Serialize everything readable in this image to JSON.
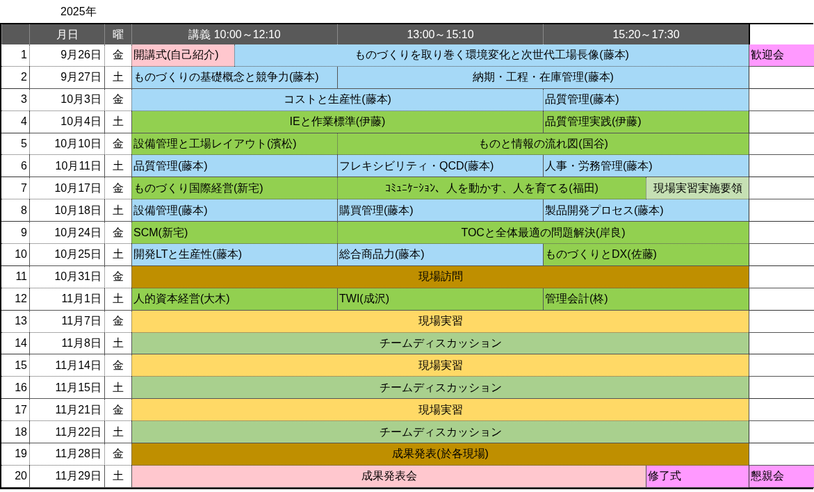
{
  "year": "2025年",
  "columns": [
    "",
    "月日",
    "曜",
    "講義 10:00～12:10",
    "13:00～15:10",
    "15:20～17:30"
  ],
  "rows": [
    {
      "no": "1",
      "date": "9月26日",
      "weekday": "金",
      "sessions": [
        {
          "text": "開講式(自己紹介)",
          "kind": "half",
          "centered": false,
          "color": "#ffc7ce"
        },
        {
          "text": "ものづくりを取り巻く環境変化と次世代工場長像(藤本)",
          "kind": "twoandhalf",
          "centered": true,
          "color": "#a6d9f7"
        }
      ],
      "extra": {
        "text": "歓迎会",
        "color": "#ff99ff"
      }
    },
    {
      "no": "2",
      "date": "9月27日",
      "weekday": "土",
      "sessions": [
        {
          "text": "ものづくりの基礎概念と競争力(藤本)",
          "kind": "one",
          "centered": false,
          "color": "#a6d9f7"
        },
        {
          "text": "納期・工程・在庫管理(藤本)",
          "kind": "two",
          "centered": true,
          "color": "#a6d9f7"
        }
      ]
    },
    {
      "no": "3",
      "date": "10月3日",
      "weekday": "金",
      "sessions": [
        {
          "text": "コストと生産性(藤本)",
          "kind": "two",
          "centered": true,
          "color": "#a6d9f7"
        },
        {
          "text": "品質管理(藤本)",
          "kind": "one",
          "centered": false,
          "color": "#a6d9f7"
        }
      ]
    },
    {
      "no": "4",
      "date": "10月4日",
      "weekday": "土",
      "sessions": [
        {
          "text": "IEと作業標準(伊藤)",
          "kind": "two",
          "centered": true,
          "color": "#92d050"
        },
        {
          "text": "品質管理実践(伊藤)",
          "kind": "one",
          "centered": false,
          "color": "#92d050"
        }
      ]
    },
    {
      "no": "5",
      "date": "10月10日",
      "weekday": "金",
      "sessions": [
        {
          "text": "設備管理と工場レイアウト(濱松)",
          "kind": "one",
          "centered": false,
          "color": "#92d050"
        },
        {
          "text": "ものと情報の流れ図(国谷)",
          "kind": "two",
          "centered": true,
          "color": "#92d050"
        }
      ]
    },
    {
      "no": "6",
      "date": "10月11日",
      "weekday": "土",
      "sessions": [
        {
          "text": "品質管理(藤本)",
          "kind": "one",
          "centered": false,
          "color": "#a6d9f7"
        },
        {
          "text": "フレキシビリティ・QCD(藤本)",
          "kind": "one",
          "centered": false,
          "color": "#a6d9f7"
        },
        {
          "text": "人事・労務管理(藤本)",
          "kind": "one",
          "centered": false,
          "color": "#a6d9f7"
        }
      ]
    },
    {
      "no": "7",
      "date": "10月17日",
      "weekday": "金",
      "sessions": [
        {
          "text": "ものづくり国際経営(新宅)",
          "kind": "one",
          "centered": false,
          "color": "#92d050"
        },
        {
          "text": "ｺﾐｭﾆｹｰｼｮﾝ、人を動かす、人を育てる(福田)",
          "kind": "oneandhalf",
          "centered": true,
          "color": "#92d050"
        },
        {
          "text": "現場実習実施要領",
          "kind": "half",
          "centered": true,
          "color": "#c6e0b4"
        }
      ]
    },
    {
      "no": "8",
      "date": "10月18日",
      "weekday": "土",
      "sessions": [
        {
          "text": "設備管理(藤本)",
          "kind": "one",
          "centered": false,
          "color": "#a6d9f7"
        },
        {
          "text": "購買管理(藤本)",
          "kind": "one",
          "centered": false,
          "color": "#a6d9f7"
        },
        {
          "text": "製品開発プロセス(藤本)",
          "kind": "one",
          "centered": false,
          "color": "#a6d9f7"
        }
      ]
    },
    {
      "no": "9",
      "date": "10月24日",
      "weekday": "金",
      "sessions": [
        {
          "text": "SCM(新宅)",
          "kind": "one",
          "centered": false,
          "color": "#92d050"
        },
        {
          "text": "TOCと全体最適の問題解決(岸良)",
          "kind": "two",
          "centered": true,
          "color": "#92d050"
        }
      ]
    },
    {
      "no": "10",
      "date": "10月25日",
      "weekday": "土",
      "sessions": [
        {
          "text": "開発LTと生産性(藤本)",
          "kind": "one",
          "centered": false,
          "color": "#a6d9f7"
        },
        {
          "text": "総合商品力(藤本)",
          "kind": "one",
          "centered": false,
          "color": "#a6d9f7"
        },
        {
          "text": "ものづくりとDX(佐藤)",
          "kind": "one",
          "centered": false,
          "color": "#92d050"
        }
      ]
    },
    {
      "no": "11",
      "date": "10月31日",
      "weekday": "金",
      "sessions": [
        {
          "text": "現場訪問",
          "kind": "three",
          "centered": true,
          "color": "#bf8f00"
        }
      ]
    },
    {
      "no": "12",
      "date": "11月1日",
      "weekday": "土",
      "sessions": [
        {
          "text": "人的資本経営(大木)",
          "kind": "one",
          "centered": false,
          "color": "#92d050"
        },
        {
          "text": "TWI(成沢)",
          "kind": "one",
          "centered": false,
          "color": "#92d050"
        },
        {
          "text": "管理会計(柊)",
          "kind": "one",
          "centered": false,
          "color": "#92d050"
        }
      ]
    },
    {
      "no": "13",
      "date": "11月7日",
      "weekday": "金",
      "sessions": [
        {
          "text": "現場実習",
          "kind": "three",
          "centered": true,
          "color": "#ffd966"
        }
      ]
    },
    {
      "no": "14",
      "date": "11月8日",
      "weekday": "土",
      "sessions": [
        {
          "text": "チームディスカッション",
          "kind": "three",
          "centered": true,
          "color": "#a9d08e"
        }
      ]
    },
    {
      "no": "15",
      "date": "11月14日",
      "weekday": "金",
      "sessions": [
        {
          "text": "現場実習",
          "kind": "three",
          "centered": true,
          "color": "#ffd966"
        }
      ]
    },
    {
      "no": "16",
      "date": "11月15日",
      "weekday": "土",
      "sessions": [
        {
          "text": "チームディスカッション",
          "kind": "three",
          "centered": true,
          "color": "#a9d08e"
        }
      ]
    },
    {
      "no": "17",
      "date": "11月21日",
      "weekday": "金",
      "sessions": [
        {
          "text": "現場実習",
          "kind": "three",
          "centered": true,
          "color": "#ffd966"
        }
      ]
    },
    {
      "no": "18",
      "date": "11月22日",
      "weekday": "土",
      "sessions": [
        {
          "text": "チームディスカッション",
          "kind": "three",
          "centered": true,
          "color": "#a9d08e"
        }
      ]
    },
    {
      "no": "19",
      "date": "11月28日",
      "weekday": "金",
      "sessions": [
        {
          "text": "成果発表(於各現場)",
          "kind": "three",
          "centered": true,
          "color": "#bf8f00"
        }
      ]
    },
    {
      "no": "20",
      "date": "11月29日",
      "weekday": "土",
      "sessions": [
        {
          "text": "成果発表会",
          "kind": "twoandhalf",
          "centered": true,
          "color": "#ffc7ce"
        },
        {
          "text": "修了式",
          "kind": "half",
          "centered": false,
          "color": "#ff99ff"
        }
      ],
      "extra": {
        "text": "懇親会",
        "color": "#ff99ff"
      }
    }
  ]
}
